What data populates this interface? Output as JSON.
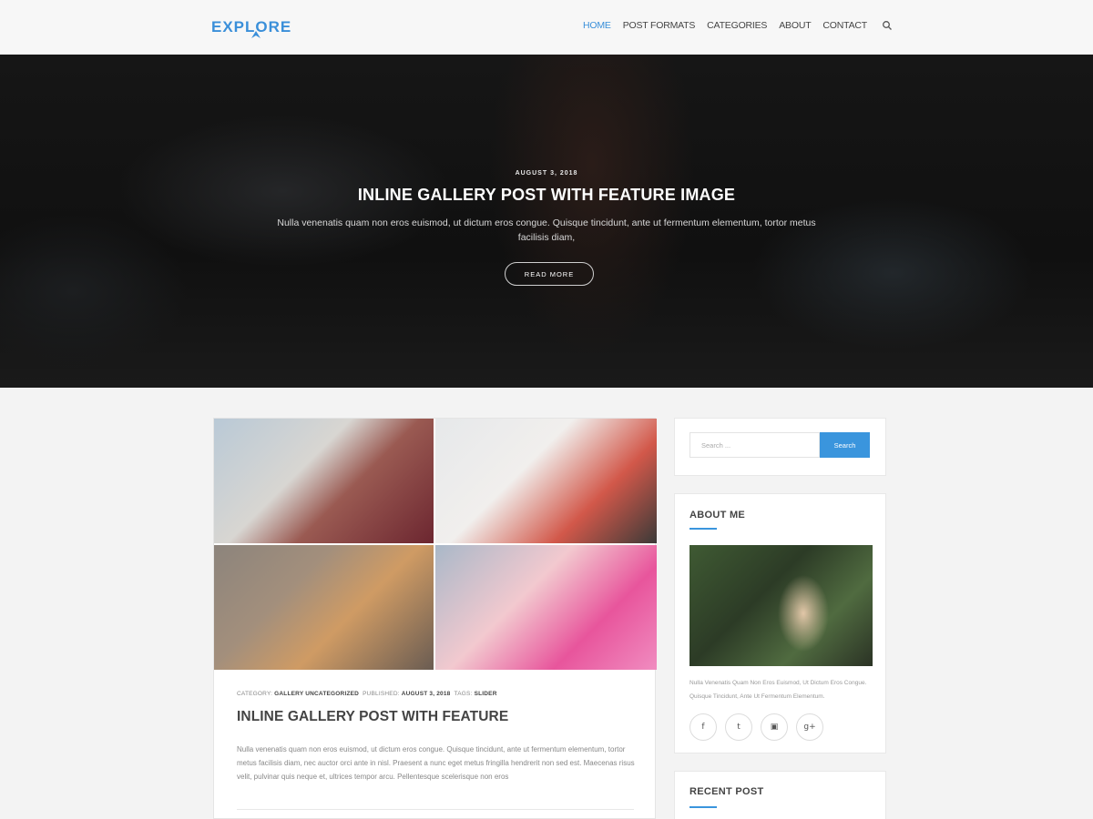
{
  "header": {
    "logo": "EXPLORE",
    "nav": [
      {
        "label": "HOME",
        "active": true
      },
      {
        "label": "POST FORMATS",
        "active": false
      },
      {
        "label": "CATEGORIES",
        "active": false
      },
      {
        "label": "ABOUT",
        "active": false
      },
      {
        "label": "CONTACT",
        "active": false
      }
    ],
    "search_icon": "search-icon"
  },
  "hero": {
    "date": "AUGUST 3, 2018",
    "title": "INLINE GALLERY POST WITH FEATURE IMAGE",
    "excerpt": "Nulla venenatis quam non eros euismod, ut dictum eros congue. Quisque tincidunt, ante ut fermentum elementum, tortor metus facilisis diam,",
    "button": "READ MORE"
  },
  "post": {
    "meta": {
      "category_label": "CATEGORY:",
      "categories": "GALLERY  UNCATEGORIZED",
      "published_label": "PUBLISHED:",
      "published": "AUGUST 3, 2018",
      "tags_label": "TAGS:",
      "tags": "SLIDER"
    },
    "title": "INLINE GALLERY POST WITH FEATURE",
    "text": "Nulla venenatis quam non eros euismod, ut dictum eros congue. Quisque tincidunt, ante ut fermentum elementum, tortor metus facilisis diam, nec auctor orci ante in nisl. Praesent a nunc eget metus fringilla hendrerit non sed est. Maecenas risus velit, pulvinar quis neque et, ultrices tempor arcu. Pellentesque scelerisque non eros"
  },
  "sidebar": {
    "search": {
      "placeholder": "Search ...",
      "button": "Search"
    },
    "about": {
      "title": "ABOUT ME",
      "text": "Nulla Venenatis Quam Non Eros Euismod, Ut Dictum Eros Congue. Quisque Tincidunt, Ante Ut Fermentum Elementum.",
      "socials": [
        {
          "icon": "facebook-icon",
          "glyph": "f"
        },
        {
          "icon": "twitter-icon",
          "glyph": "t"
        },
        {
          "icon": "instagram-icon",
          "glyph": "▣"
        },
        {
          "icon": "google-plus-icon",
          "glyph": "g+"
        }
      ]
    },
    "recent": {
      "title": "RECENT POST"
    }
  },
  "colors": {
    "accent": "#3a95dd",
    "logo": "#3a8fd9"
  }
}
